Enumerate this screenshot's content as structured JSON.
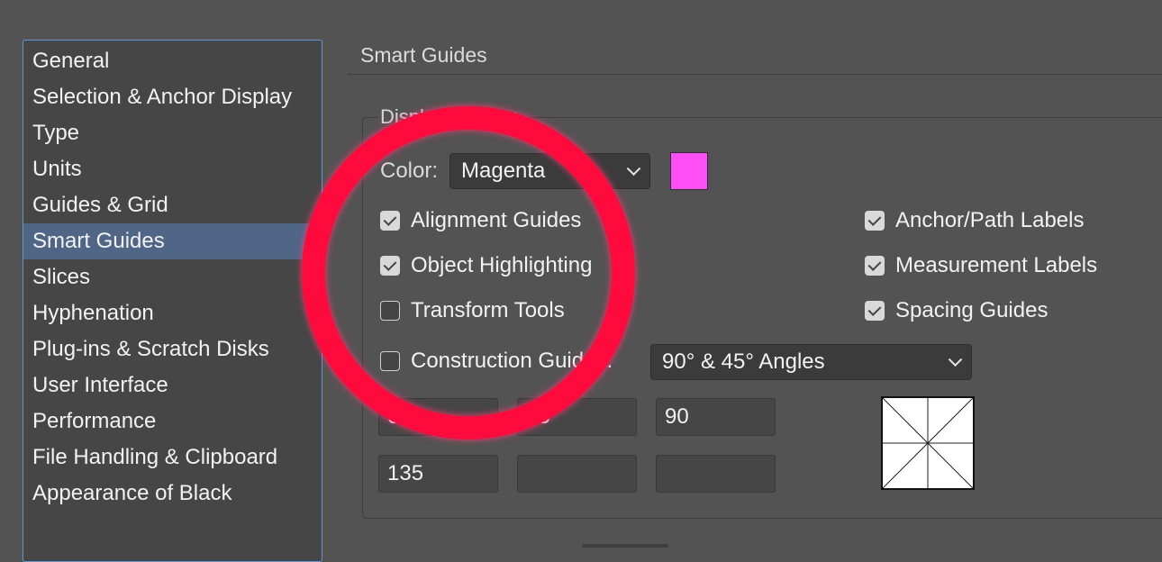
{
  "sidebar": {
    "items": [
      {
        "label": "General",
        "selected": false
      },
      {
        "label": "Selection & Anchor Display",
        "selected": false
      },
      {
        "label": "Type",
        "selected": false
      },
      {
        "label": "Units",
        "selected": false
      },
      {
        "label": "Guides & Grid",
        "selected": false
      },
      {
        "label": "Smart Guides",
        "selected": true
      },
      {
        "label": "Slices",
        "selected": false
      },
      {
        "label": "Hyphenation",
        "selected": false
      },
      {
        "label": "Plug-ins & Scratch Disks",
        "selected": false
      },
      {
        "label": "User Interface",
        "selected": false
      },
      {
        "label": "Performance",
        "selected": false
      },
      {
        "label": "File Handling & Clipboard",
        "selected": false
      },
      {
        "label": "Appearance of Black",
        "selected": false
      }
    ]
  },
  "main": {
    "section_title": "Smart Guides",
    "display_options": {
      "legend": "Display Options",
      "color_label": "Color:",
      "color_value": "Magenta",
      "swatch_color": "#ff4ef6",
      "left_checks": [
        {
          "label": "Alignment Guides",
          "checked": true
        },
        {
          "label": "Object Highlighting",
          "checked": true
        },
        {
          "label": "Transform Tools",
          "checked": false
        }
      ],
      "right_checks": [
        {
          "label": "Anchor/Path Labels",
          "checked": true
        },
        {
          "label": "Measurement Labels",
          "checked": true
        },
        {
          "label": "Spacing Guides",
          "checked": true
        }
      ],
      "construction": {
        "label": "Construction Guides:",
        "checked": false,
        "angles_value": "90° & 45° Angles",
        "angle_fields": [
          "0",
          "45",
          "90",
          "135",
          "",
          ""
        ]
      }
    }
  },
  "annotation": {
    "ring_color": "#ff0a3c"
  }
}
